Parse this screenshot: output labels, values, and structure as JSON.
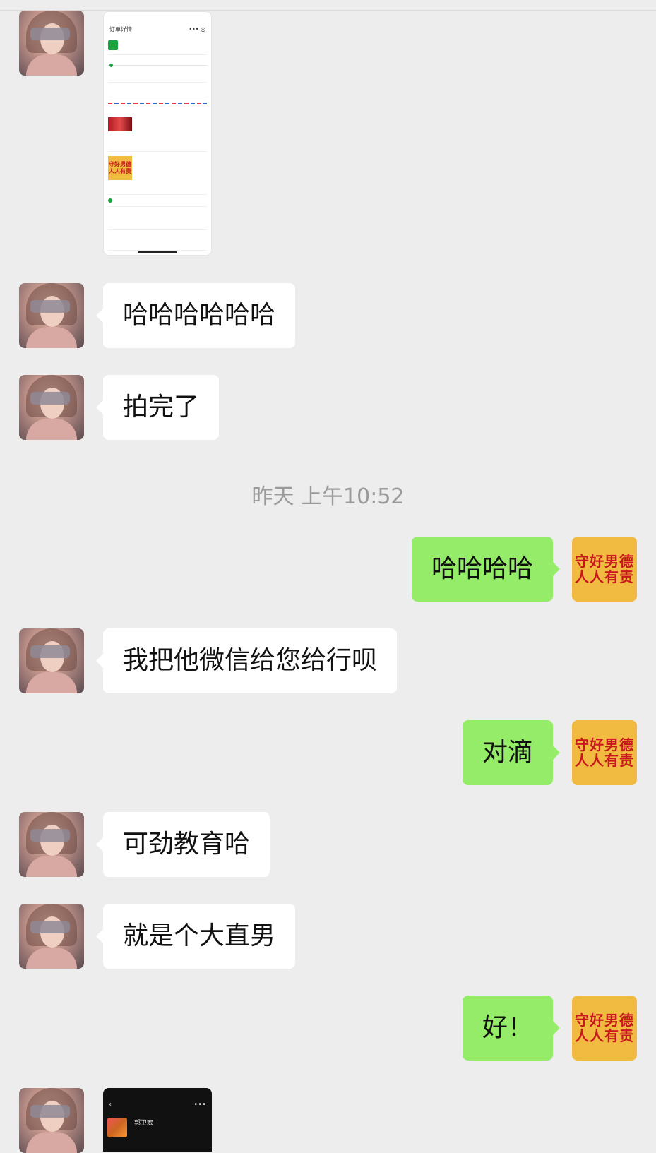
{
  "messages": [
    {
      "side": "in",
      "text": "哈哈哈哈哈哈"
    },
    {
      "side": "in",
      "text": "拍完了"
    },
    {
      "side": "out",
      "text": "哈哈哈哈"
    },
    {
      "side": "in",
      "text": "我把他微信给您给行呗"
    },
    {
      "side": "out",
      "text": "对滴"
    },
    {
      "side": "in",
      "text": "可劲教育哈"
    },
    {
      "side": "in",
      "text": "就是个大直男"
    },
    {
      "side": "out",
      "text": "好！"
    }
  ],
  "timestamp": "昨天 上午10:52",
  "my_avatar": {
    "line1": "守好男德",
    "line2": "人人有责",
    "bg": "#f1bb41",
    "fg": "#c8171e"
  },
  "colors": {
    "background": "#ededed",
    "incoming_bubble": "#ffffff",
    "outgoing_bubble": "#95ec69"
  },
  "shared_image_1": {
    "nav_title": "订单详情",
    "tile_line1": "守好男德",
    "tile_line2": "人人有责"
  },
  "shared_image_2": {
    "name": "郭卫宏"
  }
}
